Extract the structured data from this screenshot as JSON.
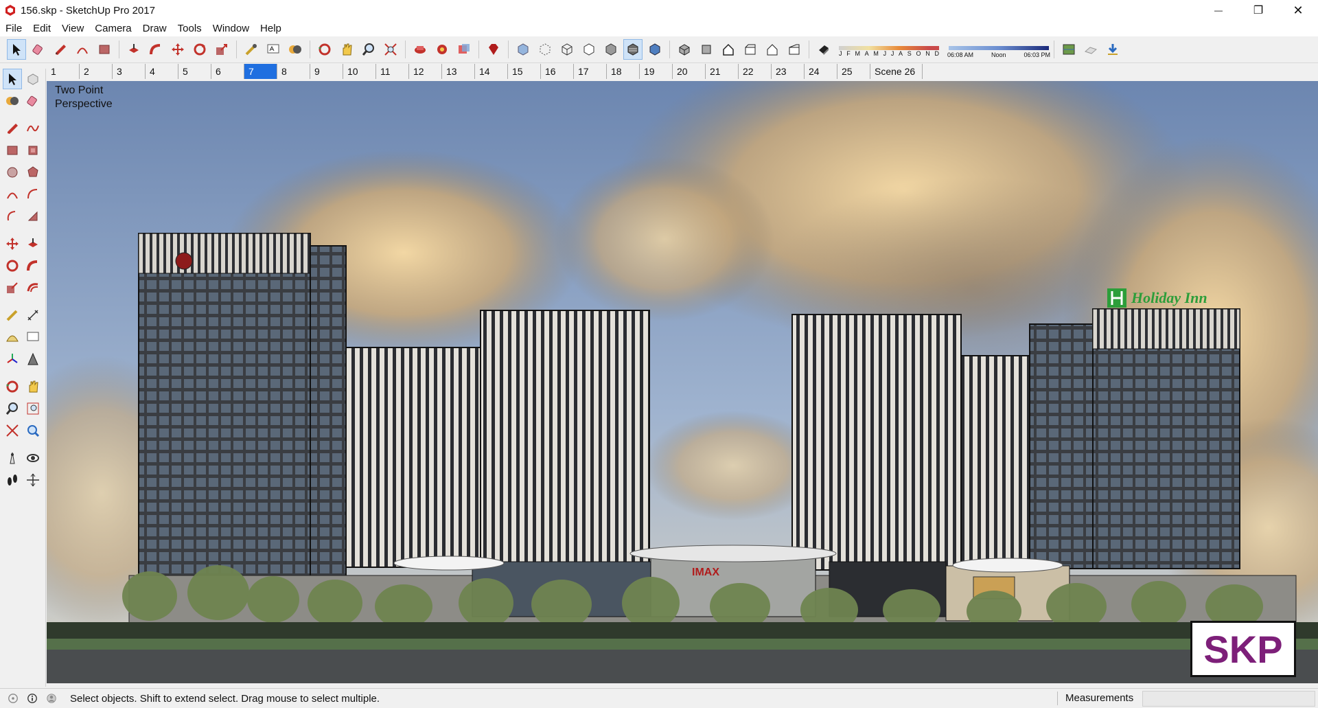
{
  "window": {
    "title": "156.skp - SketchUp Pro 2017",
    "minimize_glyph": "—",
    "maximize_glyph": "❐",
    "close_glyph": "✕"
  },
  "menu": [
    "File",
    "Edit",
    "View",
    "Camera",
    "Draw",
    "Tools",
    "Window",
    "Help"
  ],
  "toolbar": {
    "icons": [
      "select-icon",
      "eraser-icon",
      "pencil-icon",
      "arc-icon",
      "rectangle-icon",
      "push-pull-icon",
      "follow-me-icon",
      "move-icon",
      "rotate-icon",
      "scale-icon",
      "tape-measure-icon",
      "text-icon",
      "paint-bucket-icon",
      "orbit-icon",
      "pan-icon",
      "zoom-icon",
      "zoom-extents-icon",
      "warehouse-icon",
      "extension-warehouse-icon",
      "layout-icon",
      "ruby-icon",
      "xray-icon",
      "back-edges-icon",
      "wireframe-icon",
      "hidden-line-icon",
      "shaded-icon",
      "shaded-textures-icon",
      "monochrome-icon",
      "iso-view-icon",
      "top-view-icon",
      "front-view-icon",
      "right-view-icon",
      "back-view-icon",
      "left-view-icon",
      "shadows-icon"
    ],
    "shadow_months": [
      "J",
      "F",
      "M",
      "A",
      "M",
      "J",
      "J",
      "A",
      "S",
      "O",
      "N",
      "D"
    ],
    "time_start": "06:08 AM",
    "time_mid": "Noon",
    "time_end": "06:03 PM"
  },
  "scenes": {
    "tabs": [
      "1",
      "2",
      "3",
      "4",
      "5",
      "6",
      "7",
      "8",
      "9",
      "10",
      "11",
      "12",
      "13",
      "14",
      "15",
      "16",
      "17",
      "18",
      "19",
      "20",
      "21",
      "22",
      "23",
      "24",
      "25",
      "Scene 26"
    ],
    "active_index": 6
  },
  "viewport": {
    "camera_label_line1": "Two Point",
    "camera_label_line2": "Perspective",
    "sign_hotel": "Holiday Inn",
    "sign_cinema": "IMAX",
    "watermark": "SKP"
  },
  "status": {
    "hint": "Select objects. Shift to extend select. Drag mouse to select multiple.",
    "measurements_label": "Measurements",
    "measurements_value": ""
  },
  "colors": {
    "accent_tab": "#1f6fe0",
    "sky_blue": "#7b99bf",
    "watermark": "#7d1f79",
    "hotel_sign_green": "#2c9e3a"
  }
}
